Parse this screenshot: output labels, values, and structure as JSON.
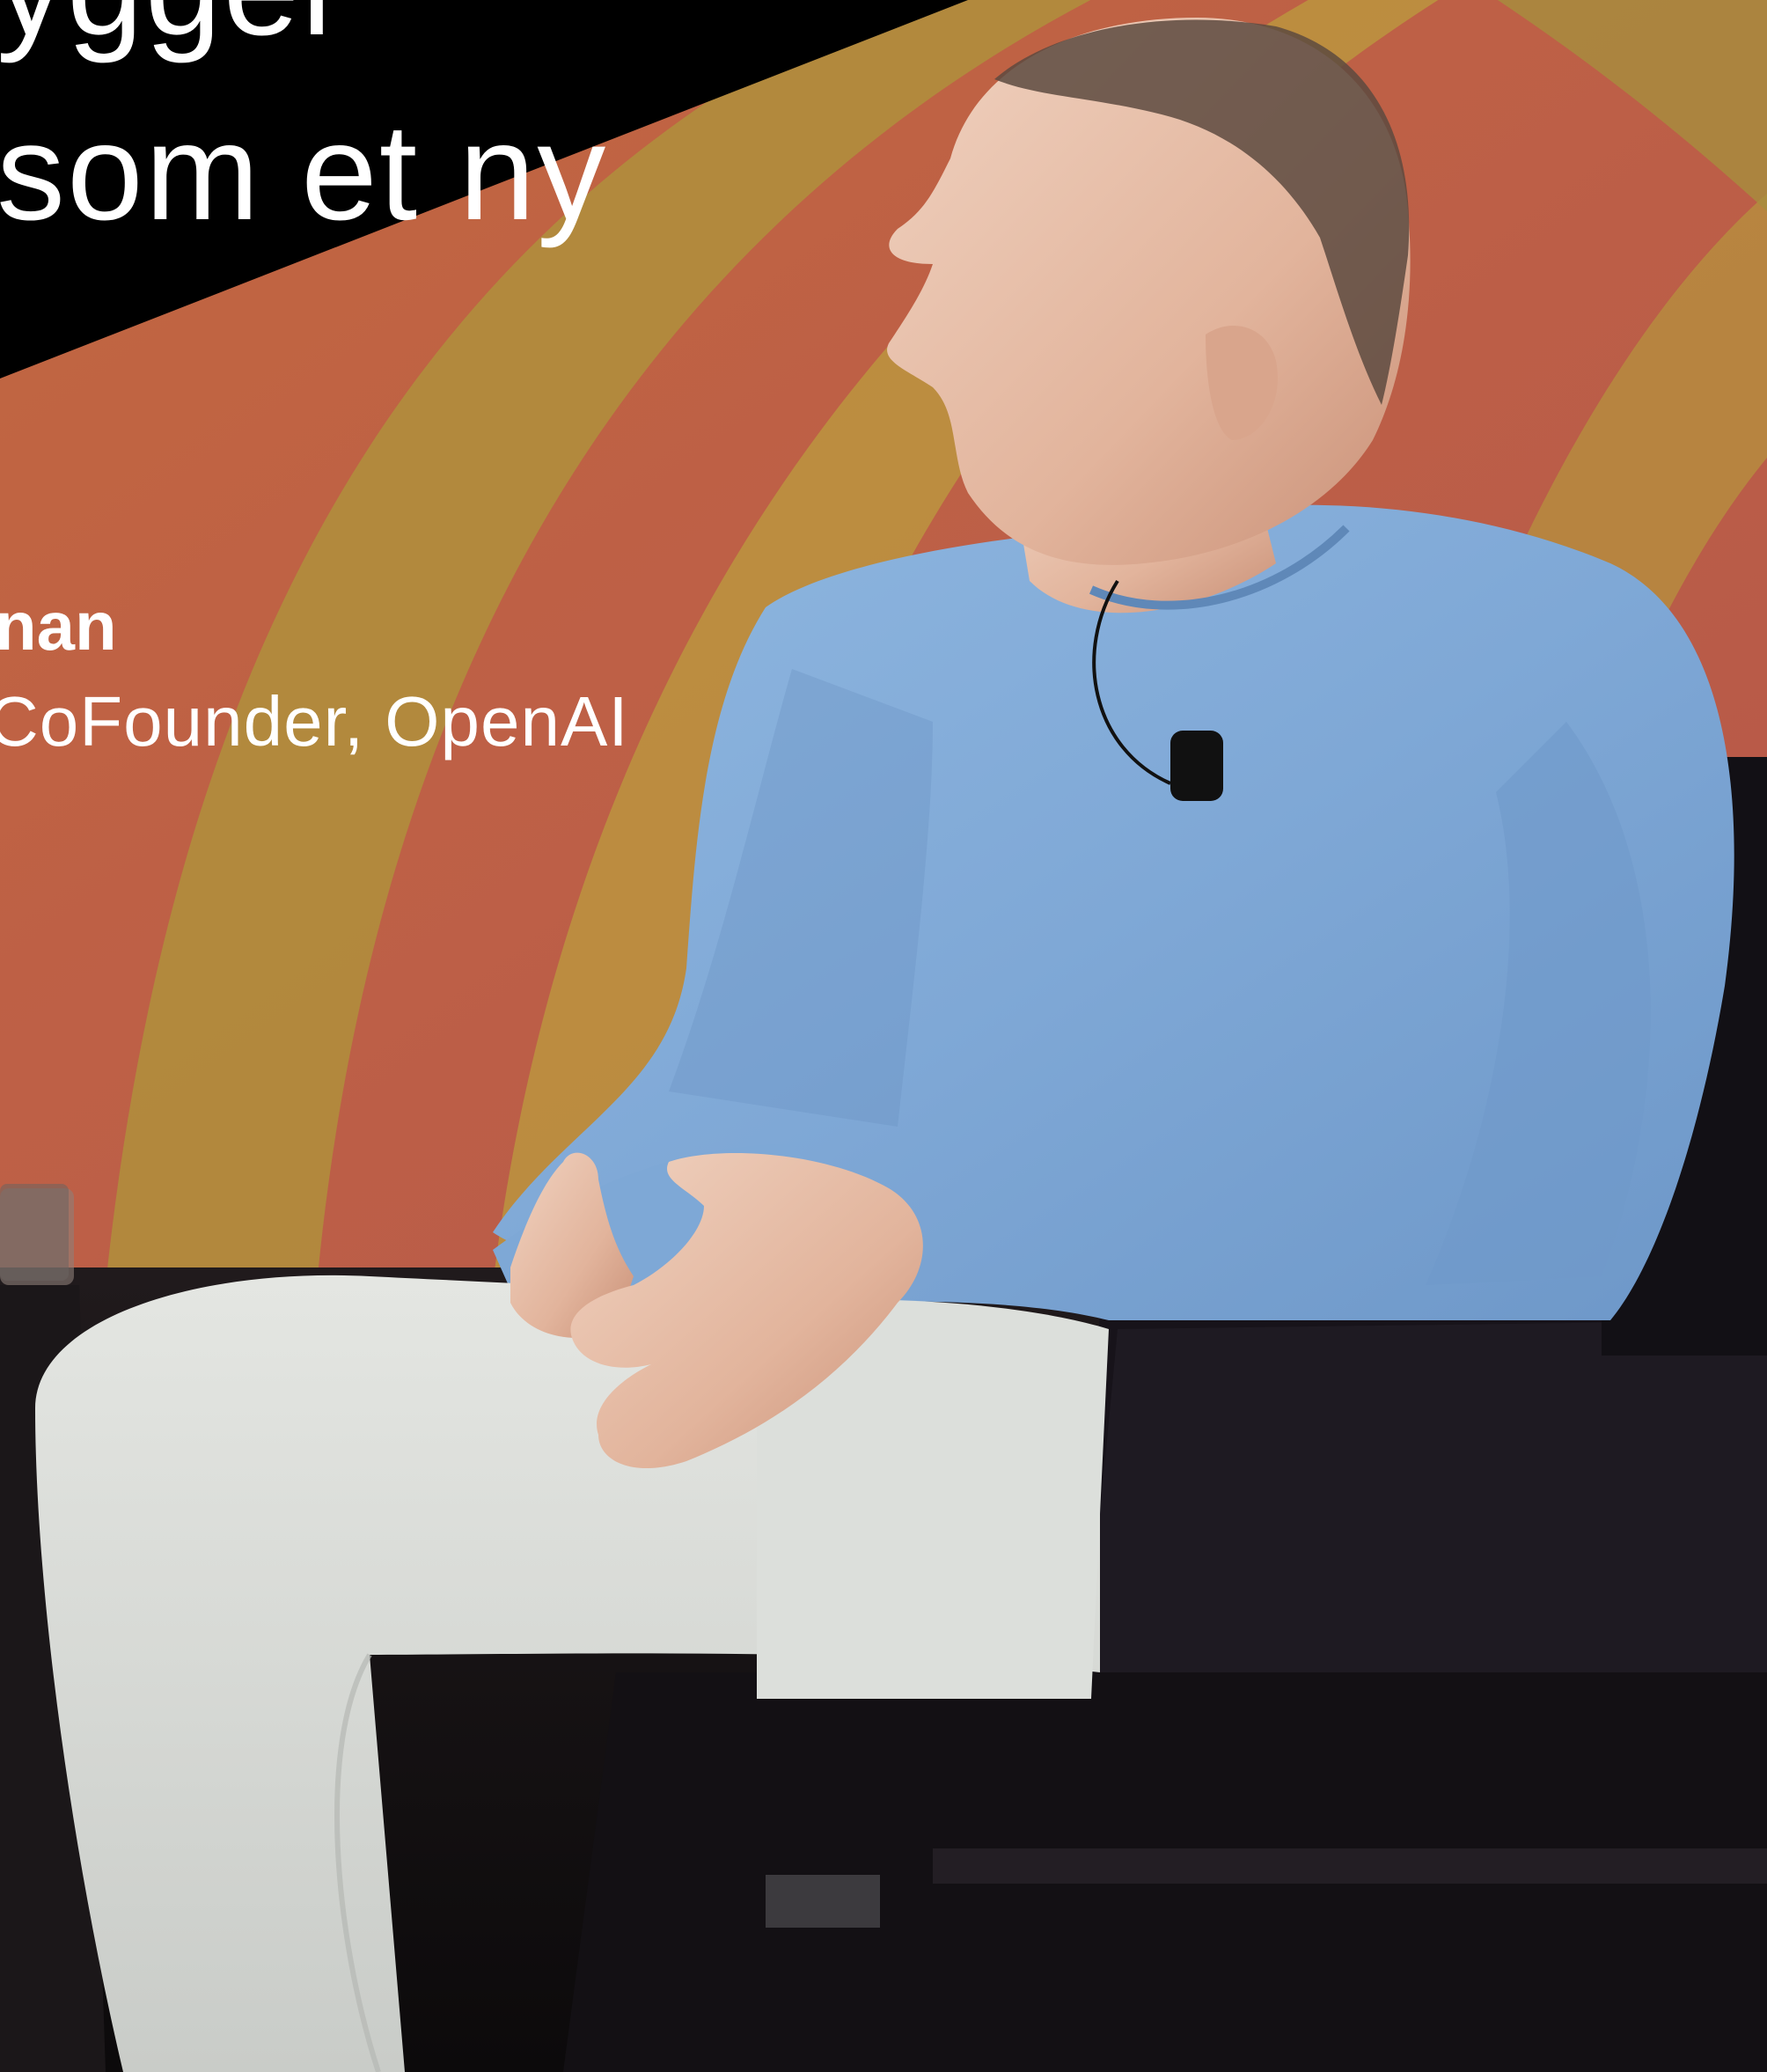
{
  "headline": {
    "line1": "ygger",
    "line2": "som et ny"
  },
  "speaker": {
    "name": "nan",
    "role": "CoFounder, OpenAI"
  }
}
